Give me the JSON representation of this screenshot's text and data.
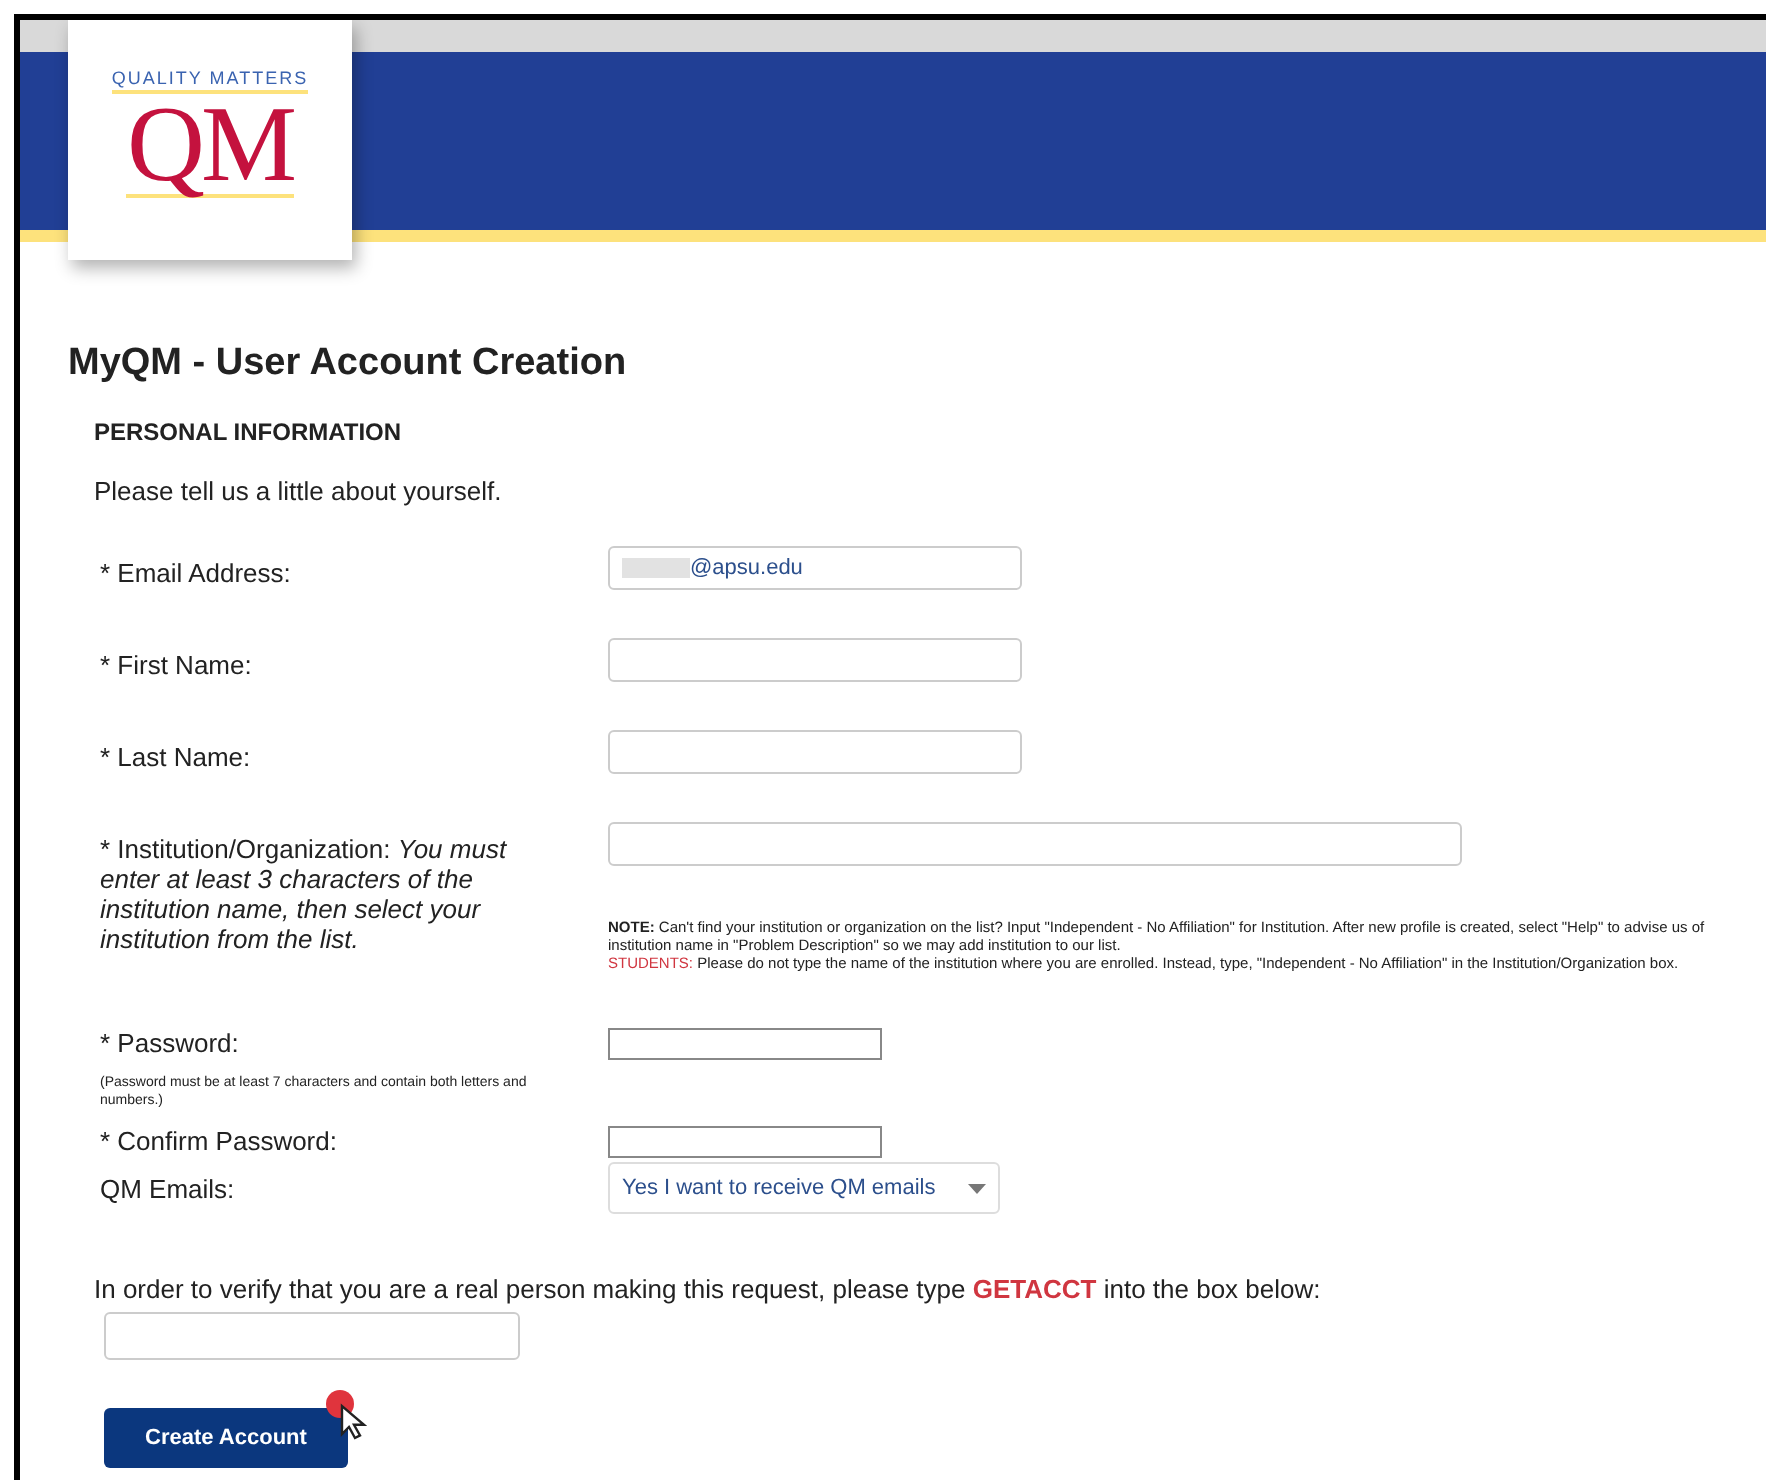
{
  "header": {
    "logo": {
      "tagline": "QUALITY MATTERS",
      "mark": "QM"
    }
  },
  "title": "MyQM - User Account Creation",
  "section_heading": "PERSONAL INFORMATION",
  "intro": "Please tell us a little about yourself.",
  "fields": [
    {
      "kind": "text",
      "label": "* Email Address:",
      "value": "@apsu.edu",
      "redacted": true
    },
    {
      "kind": "text",
      "label": "* First Name:"
    },
    {
      "kind": "text",
      "label": "* Last Name:"
    },
    {
      "kind": "wide",
      "label": "* Institution/Organization: *You must enter at least 3 characters of the institution name, then select your institution from the list.*",
      "note": "**NOTE:** Can't find your institution or organization on the list? Input \"Independent - No Affiliation\" for Institution. After new profile is created, select \"Help\" to advise us of institution name in \"Problem Description\" so we may add institution to our list.",
      "students_note": {
        "lead": "STUDENTS:",
        "text": " Please do not type the name of the institution where you are enrolled. Instead, type, \"Independent - No Affiliation\" in the Institution/Organization box."
      }
    },
    {
      "kind": "password",
      "label": "* Password:",
      "hint": "(Password must be at least 7 characters and contain both letters and numbers.)"
    },
    {
      "kind": "password",
      "label": "* Confirm Password:"
    },
    {
      "kind": "select",
      "label": "QM Emails:",
      "value": "Yes I want to receive QM emails"
    }
  ],
  "verification": {
    "before": "In order to verify that you are a real person making this request, please type ",
    "keyword": "GETACCT",
    "after": " into the box below:"
  },
  "submit": "Create Account"
}
